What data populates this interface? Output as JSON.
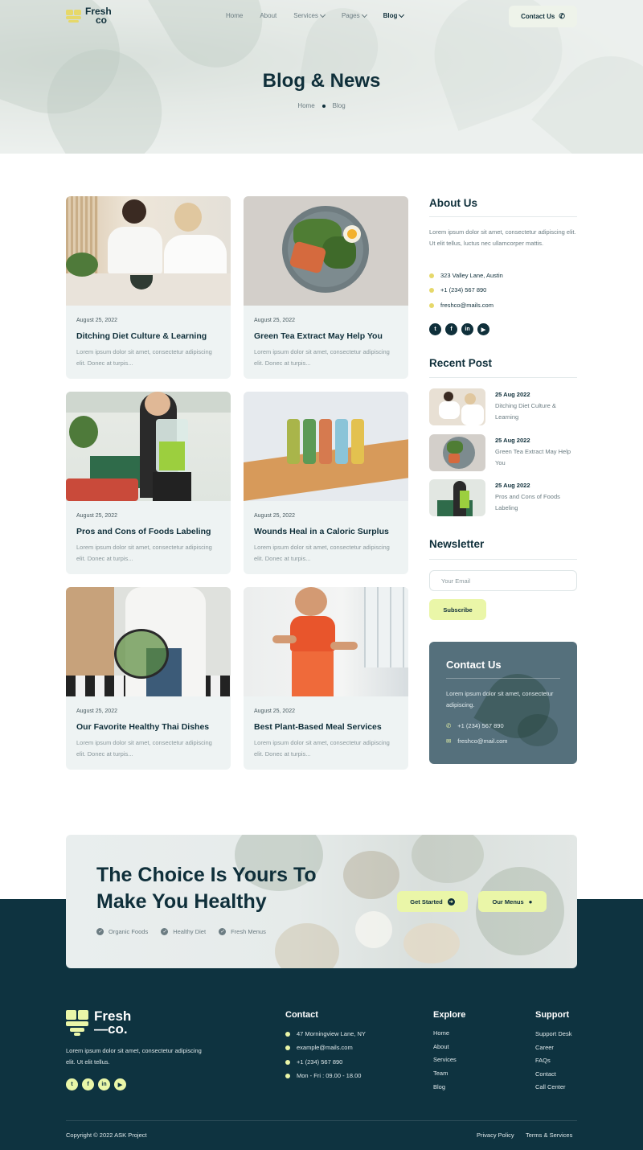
{
  "header": {
    "logo_line1": "Fresh",
    "logo_line2": "co",
    "nav": [
      {
        "label": "Home",
        "dropdown": false,
        "active": false
      },
      {
        "label": "About",
        "dropdown": false,
        "active": false
      },
      {
        "label": "Services",
        "dropdown": true,
        "active": false
      },
      {
        "label": "Pages",
        "dropdown": true,
        "active": false
      },
      {
        "label": "Blog",
        "dropdown": true,
        "active": true
      }
    ],
    "contact_label": "Contact Us"
  },
  "hero": {
    "title": "Blog & News",
    "breadcrumb": [
      "Home",
      "Blog"
    ]
  },
  "posts": [
    {
      "date": "August 25, 2022",
      "title": "Ditching Diet Culture & Learning",
      "excerpt": "Lorem ipsum dolor sit amet, consectetur adipiscing elit. Donec at turpis..."
    },
    {
      "date": "August 25, 2022",
      "title": "Green Tea Extract May Help You",
      "excerpt": "Lorem ipsum dolor sit amet, consectetur adipiscing elit. Donec at turpis..."
    },
    {
      "date": "August 25, 2022",
      "title": "Pros and Cons of Foods Labeling",
      "excerpt": "Lorem ipsum dolor sit amet, consectetur adipiscing elit. Donec at turpis..."
    },
    {
      "date": "August 25, 2022",
      "title": "Wounds Heal in a Caloric Surplus",
      "excerpt": "Lorem ipsum dolor sit amet, consectetur adipiscing elit. Donec at turpis..."
    },
    {
      "date": "August 25, 2022",
      "title": "Our Favorite Healthy Thai Dishes",
      "excerpt": "Lorem ipsum dolor sit amet, consectetur adipiscing elit. Donec at turpis..."
    },
    {
      "date": "August 25, 2022",
      "title": "Best Plant-Based Meal Services",
      "excerpt": "Lorem ipsum dolor sit amet, consectetur adipiscing elit. Donec at turpis..."
    }
  ],
  "sidebar": {
    "about": {
      "heading": "About Us",
      "text": "Lorem ipsum dolor sit amet, consectetur adipiscing elit. Ut elit tellus, luctus nec ullamcorper mattis.",
      "address": "323 Valley Lane, Austin",
      "phone": "+1 (234) 567 890",
      "email": "freshco@mails.com"
    },
    "recent": {
      "heading": "Recent Post",
      "items": [
        {
          "date": "25 Aug 2022",
          "title": "Ditching Diet Culture & Learning"
        },
        {
          "date": "25 Aug 2022",
          "title": "Green Tea Extract May Help You"
        },
        {
          "date": "25 Aug 2022",
          "title": "Pros and Cons of Foods Labeling"
        }
      ]
    },
    "newsletter": {
      "heading": "Newsletter",
      "placeholder": "Your Email",
      "button": "Subscribe"
    },
    "contact": {
      "heading": "Contact Us",
      "text": "Lorem ipsum dolor sit amet, consectetur adipiscing.",
      "phone": "+1 (234) 567 890",
      "email": "freshco@mail.com"
    }
  },
  "cta": {
    "title": "The Choice Is Yours To Make You Healthy",
    "checks": [
      "Organic Foods",
      "Healthy Diet",
      "Fresh Menus"
    ],
    "btn_primary": "Get Started",
    "btn_secondary": "Our Menus"
  },
  "footer": {
    "logo_line1": "Fresh",
    "logo_line2": "—co.",
    "desc": "Lorem ipsum dolor sit amet, consectetur adipiscing elit. Ut elit tellus.",
    "contact_heading": "Contact",
    "contact": [
      "47 Morningview Lane, NY",
      "example@mails.com",
      "+1 (234) 567 890",
      "Mon - Fri : 09.00 - 18.00"
    ],
    "explore_heading": "Explore",
    "explore": [
      "Home",
      "About",
      "Services",
      "Team",
      "Blog"
    ],
    "support_heading": "Support",
    "support": [
      "Support Desk",
      "Career",
      "FAQs",
      "Contact",
      "Call Center"
    ],
    "copyright": "Copyright © 2022 ASK Project",
    "privacy": "Privacy Policy",
    "terms": "Terms & Services"
  },
  "colors": {
    "dark": "#0e3340",
    "accent_lime": "#eaf6a8",
    "accent_yellow": "#e6d86a",
    "card_bg": "#eef3f3",
    "contact_card": "#55707c"
  }
}
